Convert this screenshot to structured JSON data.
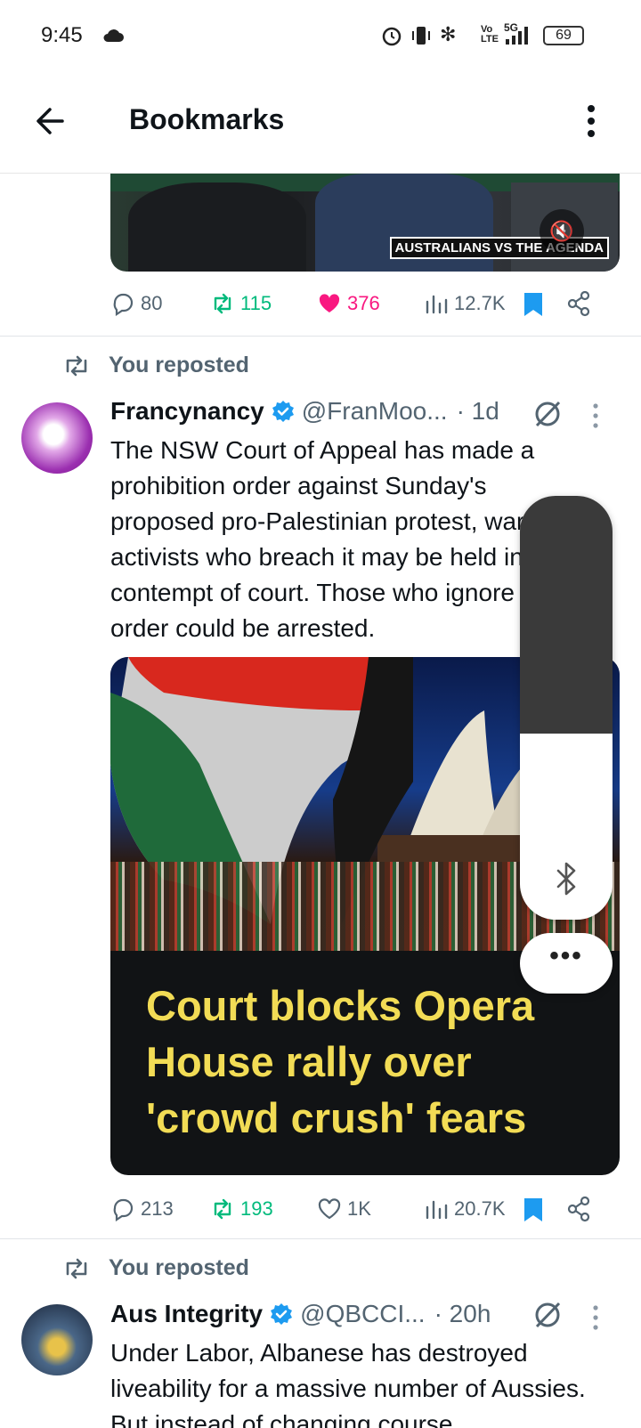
{
  "status_bar": {
    "time": "9:45",
    "network": "5G",
    "battery": "69"
  },
  "header": {
    "title": "Bookmarks"
  },
  "top_media": {
    "badge_text": "AUSTRALIANS VS THE AGENDA"
  },
  "tweet0": {
    "replies": "80",
    "reposts": "115",
    "likes": "376",
    "views": "12.7K",
    "liked": true,
    "bookmarked": true
  },
  "tweet1": {
    "repost_label": "You reposted",
    "name": "Francynancy",
    "handle": "@FranMoo...",
    "time": "· 1d",
    "text": "The NSW Court of Appeal has made a prohibition order against Sunday's proposed pro-Palestinian protest, warning activists who breach it may be held in contempt of court. Those who ignore the order could be arrested.",
    "card_headline": "Court blocks Opera House rally over 'crowd crush' fears",
    "replies": "213",
    "reposts": "193",
    "likes": "1K",
    "views": "20.7K",
    "bookmarked": true
  },
  "tweet2": {
    "repost_label": "You reposted",
    "name": "Aus Integrity",
    "handle": "@QBCCI...",
    "time": "· 20h",
    "text": "Under Labor, Albanese has destroyed liveability for a massive number of Aussies. But instead of changing course"
  },
  "volume_panel": {
    "level": 0.44,
    "more_label": "•••"
  },
  "colors": {
    "repost_green": "#00ba7c",
    "like_pink": "#f91880",
    "bookmark_blue": "#1d9bf0",
    "verified_blue": "#1d9bf0",
    "headline_yellow": "#f2dc55"
  },
  "icons": [
    "back-arrow-icon",
    "more-vertical-icon",
    "reply-icon",
    "repost-icon",
    "like-icon",
    "views-icon",
    "bookmark-icon",
    "share-icon",
    "verified-icon",
    "grok-icon",
    "bluetooth-icon",
    "mute-icon"
  ]
}
